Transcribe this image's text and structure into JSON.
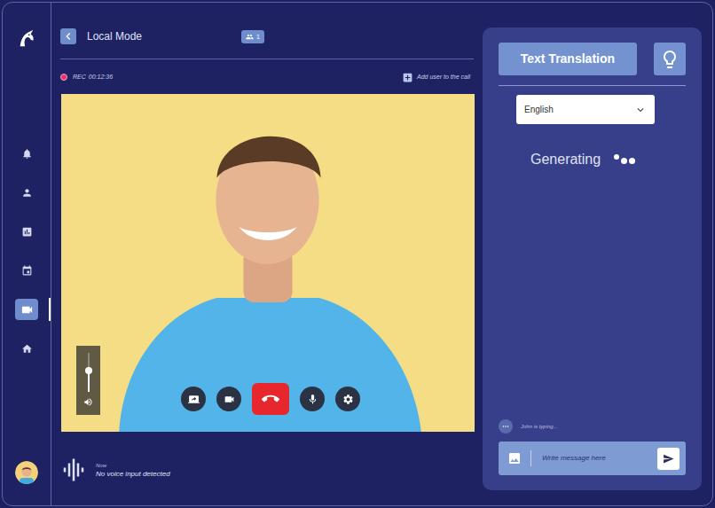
{
  "sidebar": {
    "items": [
      {
        "selected": false
      },
      {
        "selected": false
      },
      {
        "selected": false
      },
      {
        "selected": false
      },
      {
        "selected": true
      },
      {
        "selected": false
      }
    ]
  },
  "header": {
    "title": "Local Mode",
    "participants": "1"
  },
  "recording": {
    "label": "REC",
    "time": "00:12:36",
    "on": true
  },
  "add_user": "Add user to the call",
  "call": {
    "volume": {
      "level": 0.55
    }
  },
  "voice": {
    "time": "Now",
    "status": "No voice input detected"
  },
  "translation": {
    "title": "Text Translation",
    "language": "English",
    "status": "Generating",
    "typing": "John is typing...",
    "input_placeholder": "Write message here"
  }
}
